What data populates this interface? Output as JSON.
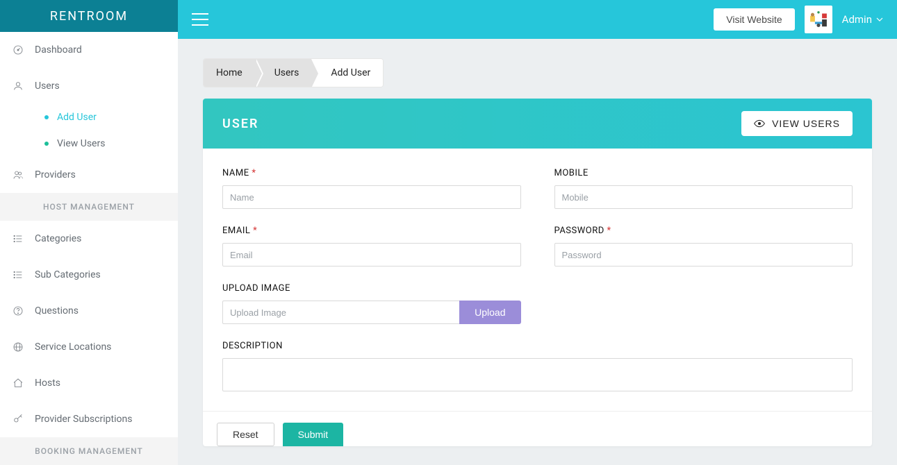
{
  "brand": "RENTROOM",
  "header": {
    "visit_label": "Visit Website",
    "admin_label": "Admin"
  },
  "sidebar": {
    "items": [
      {
        "label": "Dashboard",
        "icon": "dashboard"
      },
      {
        "label": "Users",
        "icon": "user",
        "children": [
          {
            "label": "Add User",
            "dot_color": "#26c6da",
            "active": true
          },
          {
            "label": "View Users",
            "dot_color": "#1dbf99",
            "active": false
          }
        ]
      },
      {
        "label": "Providers",
        "icon": "users"
      }
    ],
    "sections": [
      {
        "title": "HOST MANAGEMENT",
        "items": [
          {
            "label": "Categories",
            "icon": "list"
          },
          {
            "label": "Sub Categories",
            "icon": "list"
          },
          {
            "label": "Questions",
            "icon": "question"
          },
          {
            "label": "Service Locations",
            "icon": "globe"
          },
          {
            "label": "Hosts",
            "icon": "home"
          },
          {
            "label": "Provider Subscriptions",
            "icon": "key"
          }
        ]
      },
      {
        "title": "BOOKING MANAGEMENT",
        "items": []
      }
    ]
  },
  "breadcrumb": [
    "Home",
    "Users",
    "Add User"
  ],
  "card": {
    "title": "USER",
    "view_users_label": "VIEW USERS"
  },
  "form": {
    "name": {
      "label": "NAME",
      "required": true,
      "placeholder": "Name",
      "value": ""
    },
    "mobile": {
      "label": "MOBILE",
      "required": false,
      "placeholder": "Mobile",
      "value": ""
    },
    "email": {
      "label": "EMAIL",
      "required": true,
      "placeholder": "Email",
      "value": ""
    },
    "password": {
      "label": "PASSWORD",
      "required": true,
      "placeholder": "Password",
      "value": ""
    },
    "upload": {
      "label": "UPLOAD IMAGE",
      "placeholder": "Upload Image",
      "value": "",
      "button": "Upload"
    },
    "description": {
      "label": "DESCRIPTION",
      "value": ""
    },
    "reset_label": "Reset",
    "submit_label": "Submit"
  },
  "required_marker": "*"
}
